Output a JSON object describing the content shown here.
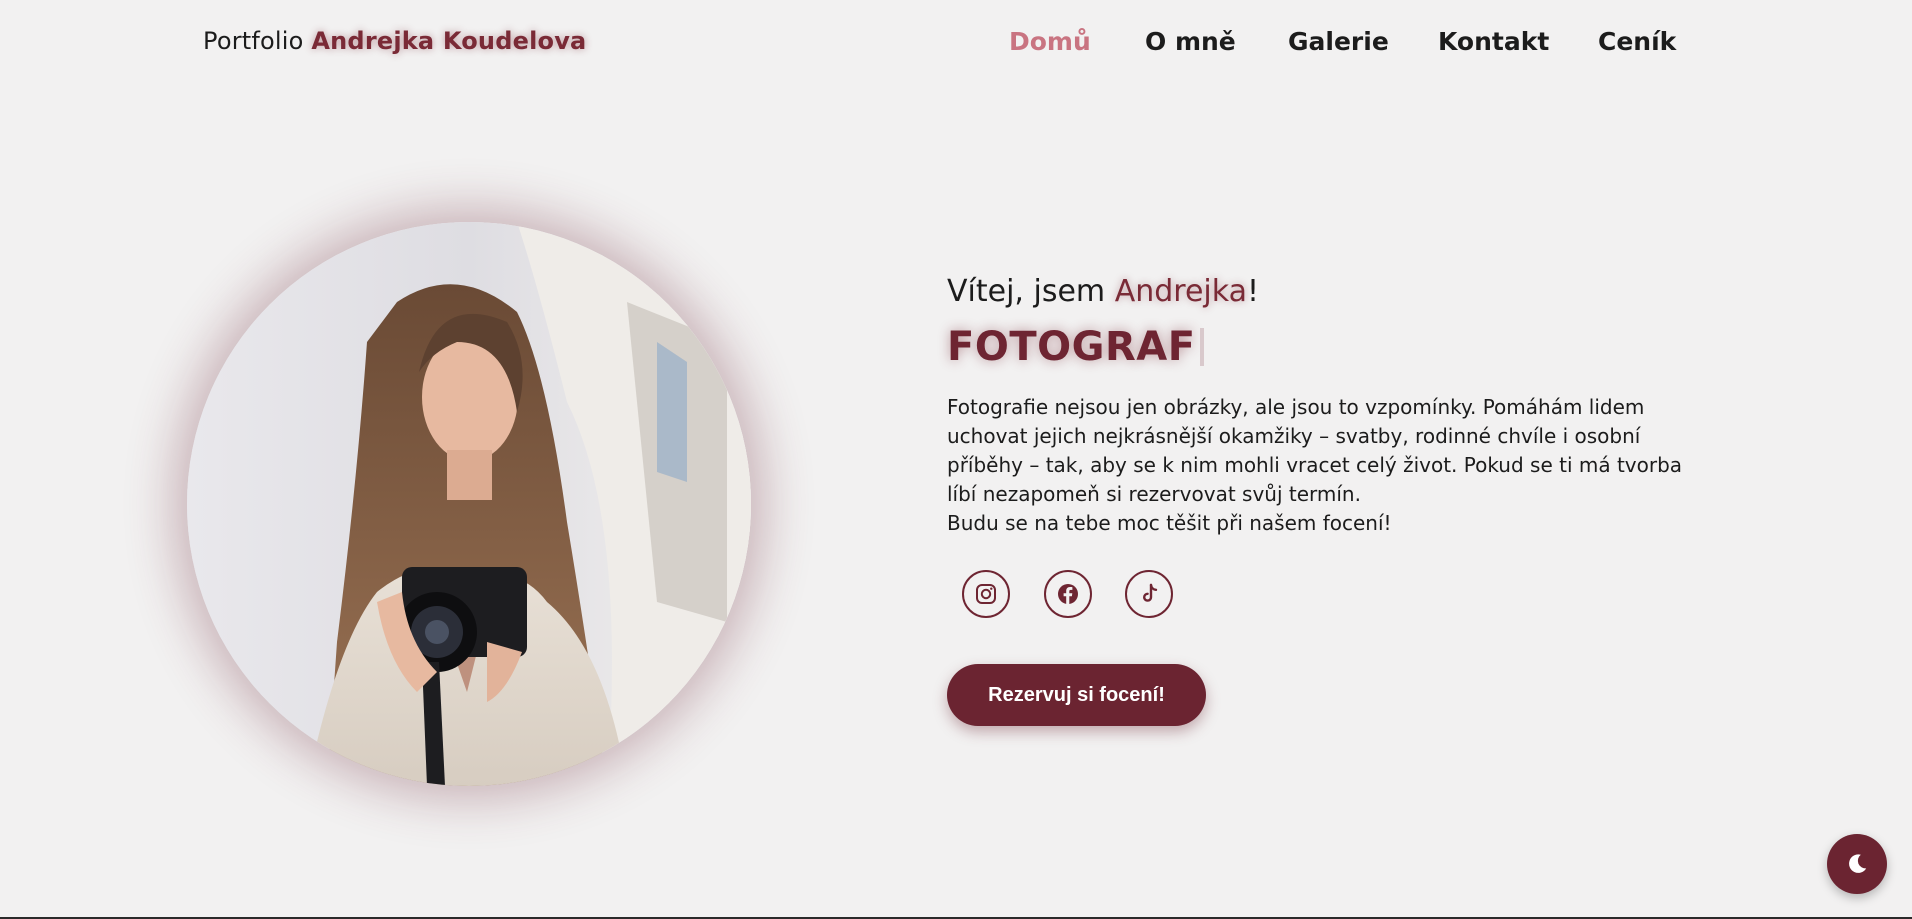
{
  "header": {
    "logo_prefix": "Portfolio",
    "logo_name": "Andrejka Koudelova"
  },
  "nav": {
    "items": [
      {
        "label": "Domů",
        "active": true
      },
      {
        "label": "O mně",
        "active": false
      },
      {
        "label": "Galerie",
        "active": false
      },
      {
        "label": "Kontakt",
        "active": false
      },
      {
        "label": "Ceník",
        "active": false
      }
    ]
  },
  "hero": {
    "greeting_prefix": "Vítej, jsem",
    "greeting_name": "Andrejka",
    "greeting_suffix": "!",
    "role": "FOTOGRAF",
    "description_1": "Fotografie nejsou jen obrázky, ale jsou to vzpomínky. Pomáhám lidem uchovat jejich nejkrásnější okamžiky – svatby, rodinné chvíle i osobní příběhy – tak, aby se k nim mohli vracet celý život. Pokud se ti má tvorba líbí nezapomeň si rezervovat svůj termín.",
    "description_2": "Budu se na tebe moc těšit při našem focení!",
    "cta_label": "Rezervuj si focení!"
  },
  "social": {
    "items": [
      {
        "icon": "instagram-icon"
      },
      {
        "icon": "facebook-icon"
      },
      {
        "icon": "tiktok-icon"
      }
    ]
  },
  "theme_toggle": {
    "icon": "moon-icon"
  },
  "colors": {
    "background": "#f2f1f1",
    "accent": "#6b2431",
    "accent_light": "#c97481",
    "text": "#1c1c1c"
  }
}
